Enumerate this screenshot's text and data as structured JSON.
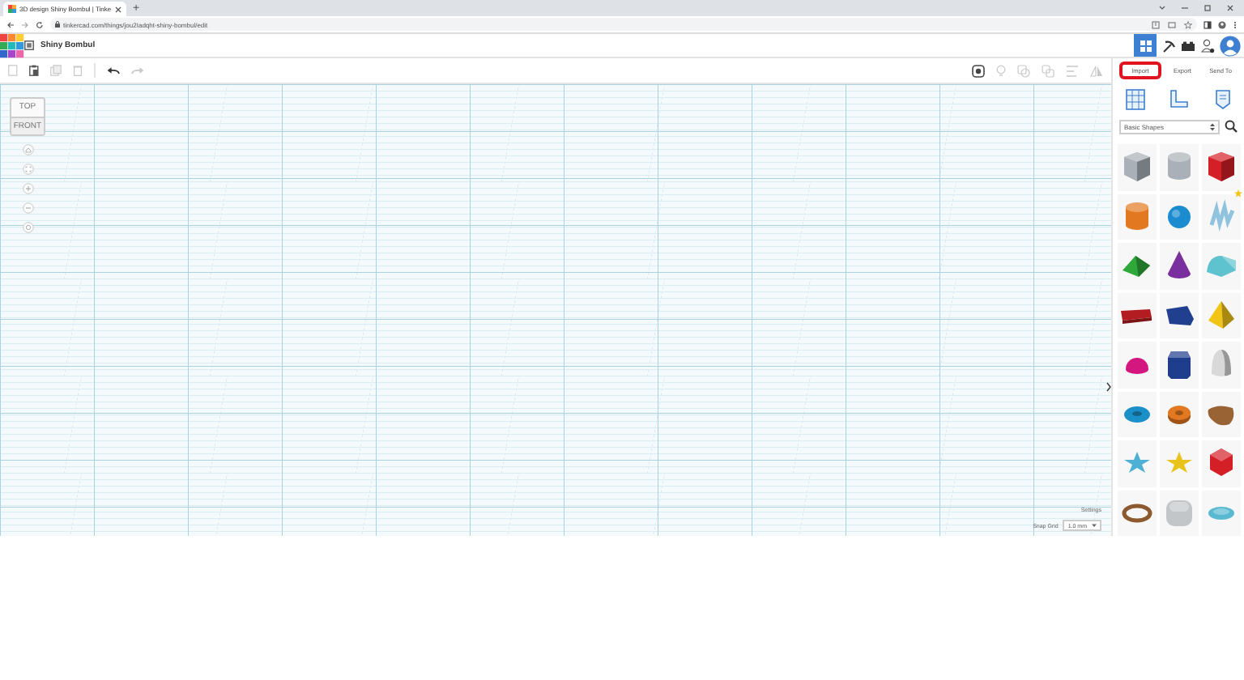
{
  "browser": {
    "tab_title": "3D design Shiny Bombul | Tinke",
    "new_tab": "+",
    "url": "tinkercad.com/things/jou2Iadqht-shiny-bombul/edit"
  },
  "header": {
    "design_title": "Shiny Bombul"
  },
  "view_cube": {
    "top": "TOP",
    "front": "FRONT"
  },
  "panel": {
    "actions": [
      {
        "label": "Import",
        "selected": true
      },
      {
        "label": "Export",
        "selected": false
      },
      {
        "label": "Send To",
        "selected": false
      }
    ],
    "category": "Basic Shapes",
    "shapes": [
      {
        "kind": "box",
        "color": "#a9b0b8",
        "starred": false
      },
      {
        "kind": "cylinder",
        "color": "#a9b0b8",
        "starred": false
      },
      {
        "kind": "box",
        "color": "#d41f26",
        "starred": false
      },
      {
        "kind": "cylinder",
        "color": "#e2781f",
        "starred": false
      },
      {
        "kind": "sphere",
        "color": "#1a8ccf",
        "starred": false
      },
      {
        "kind": "scribble",
        "color": "#8fc3de",
        "starred": true
      },
      {
        "kind": "roof",
        "color": "#2fa83a",
        "starred": false
      },
      {
        "kind": "cone",
        "color": "#7a2f9e",
        "starred": false
      },
      {
        "kind": "round-roof",
        "color": "#5fc3cf",
        "starred": false
      },
      {
        "kind": "text",
        "color": "#b31c20",
        "starred": false
      },
      {
        "kind": "plate",
        "color": "#213f8f",
        "starred": false
      },
      {
        "kind": "pyramid",
        "color": "#f2c415",
        "starred": false
      },
      {
        "kind": "half-sphere",
        "color": "#d3177f",
        "starred": false
      },
      {
        "kind": "hexagon",
        "color": "#1e3d8c",
        "starred": false
      },
      {
        "kind": "paraboloid",
        "color": "#d8d8d8",
        "starred": false
      },
      {
        "kind": "torus",
        "color": "#1b8fc7",
        "starred": false
      },
      {
        "kind": "tube",
        "color": "#e2781f",
        "starred": false
      },
      {
        "kind": "blob",
        "color": "#9a6334",
        "starred": false
      },
      {
        "kind": "star",
        "color": "#4fb0d6",
        "starred": false
      },
      {
        "kind": "star",
        "color": "#e8c41a",
        "starred": false
      },
      {
        "kind": "gem",
        "color": "#d41f26",
        "starred": false
      },
      {
        "kind": "ring",
        "color": "#8c5a2e",
        "starred": false
      },
      {
        "kind": "rounded-box",
        "color": "#c3c6c9",
        "starred": false
      },
      {
        "kind": "ellipsoid",
        "color": "#59b9d0",
        "starred": false
      }
    ]
  },
  "footer": {
    "settings": "Settings",
    "snap_label": "Snap Grid",
    "snap_value": "1.0 mm"
  }
}
